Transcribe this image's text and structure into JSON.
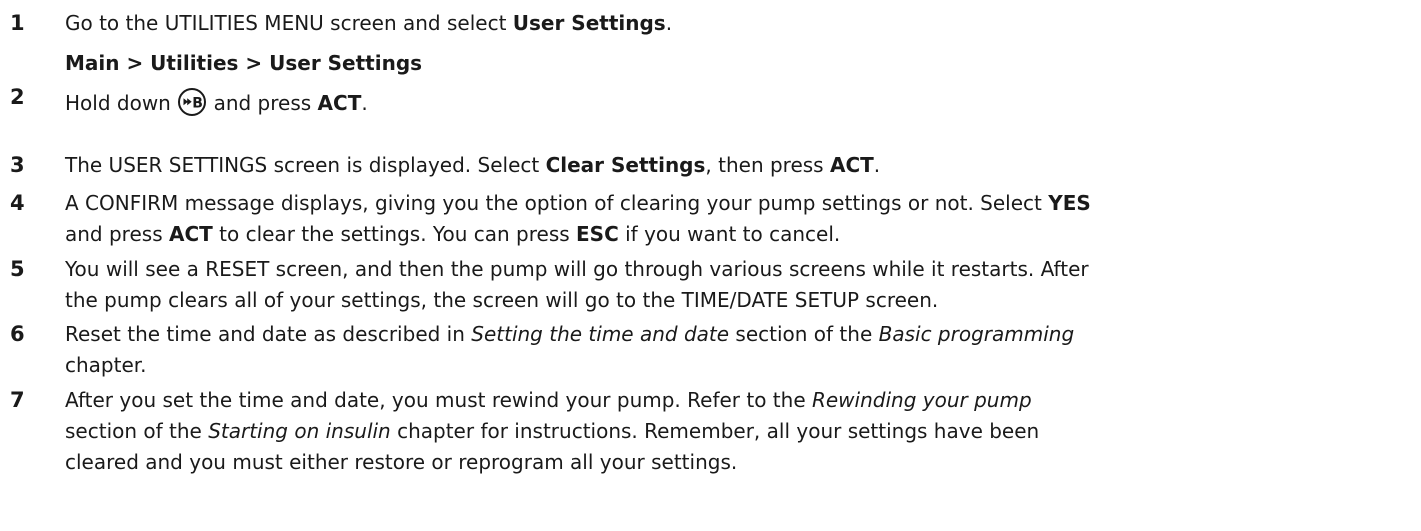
{
  "steps": [
    {
      "number": "1",
      "segments": [
        {
          "t": "Go to the UTILITIES MENU screen and select "
        },
        {
          "t": "User Settings",
          "b": true
        },
        {
          "t": "."
        }
      ],
      "path": "Main > Utilities > User Settings"
    },
    {
      "number": "2",
      "segments": [
        {
          "t": "Hold down "
        },
        {
          "icon": "b-button-icon"
        },
        {
          "t": " and press "
        },
        {
          "t": "ACT",
          "b": true
        },
        {
          "t": "."
        }
      ]
    },
    {
      "number": "3",
      "segments": [
        {
          "t": "The USER SETTINGS screen is displayed. Select "
        },
        {
          "t": "Clear Settings",
          "b": true
        },
        {
          "t": ", then press "
        },
        {
          "t": "ACT",
          "b": true
        },
        {
          "t": "."
        }
      ]
    },
    {
      "number": "4",
      "lines": [
        [
          {
            "t": "A CONFIRM message displays, giving you the option of clearing your pump settings or not. Select "
          },
          {
            "t": "YES",
            "b": true
          }
        ],
        [
          {
            "t": "and press "
          },
          {
            "t": "ACT",
            "b": true
          },
          {
            "t": " to clear the settings. You can press "
          },
          {
            "t": "ESC",
            "b": true
          },
          {
            "t": " if you want to cancel."
          }
        ]
      ]
    },
    {
      "number": "5",
      "lines": [
        [
          {
            "t": "You will see a RESET screen, and then the pump will go through various screens while it restarts. After"
          }
        ],
        [
          {
            "t": "the pump clears all of your settings, the screen will go to the TIME/DATE SETUP screen."
          }
        ]
      ]
    },
    {
      "number": "6",
      "lines": [
        [
          {
            "t": "Reset the time and date as described in "
          },
          {
            "t": "Setting the time and date",
            "i": true
          },
          {
            "t": " section of the "
          },
          {
            "t": "Basic programming",
            "i": true
          }
        ],
        [
          {
            "t": "chapter."
          }
        ]
      ]
    },
    {
      "number": "7",
      "lines": [
        [
          {
            "t": "After you set the time and date, you must rewind your pump. Refer to the "
          },
          {
            "t": "Rewinding your pump",
            "i": true
          }
        ],
        [
          {
            "t": "section of the "
          },
          {
            "t": "Starting on insulin",
            "i": true
          },
          {
            "t": " chapter for instructions. Remember, all your settings have been"
          }
        ],
        [
          {
            "t": "cleared and you must either restore or reprogram all your settings."
          }
        ]
      ]
    }
  ]
}
